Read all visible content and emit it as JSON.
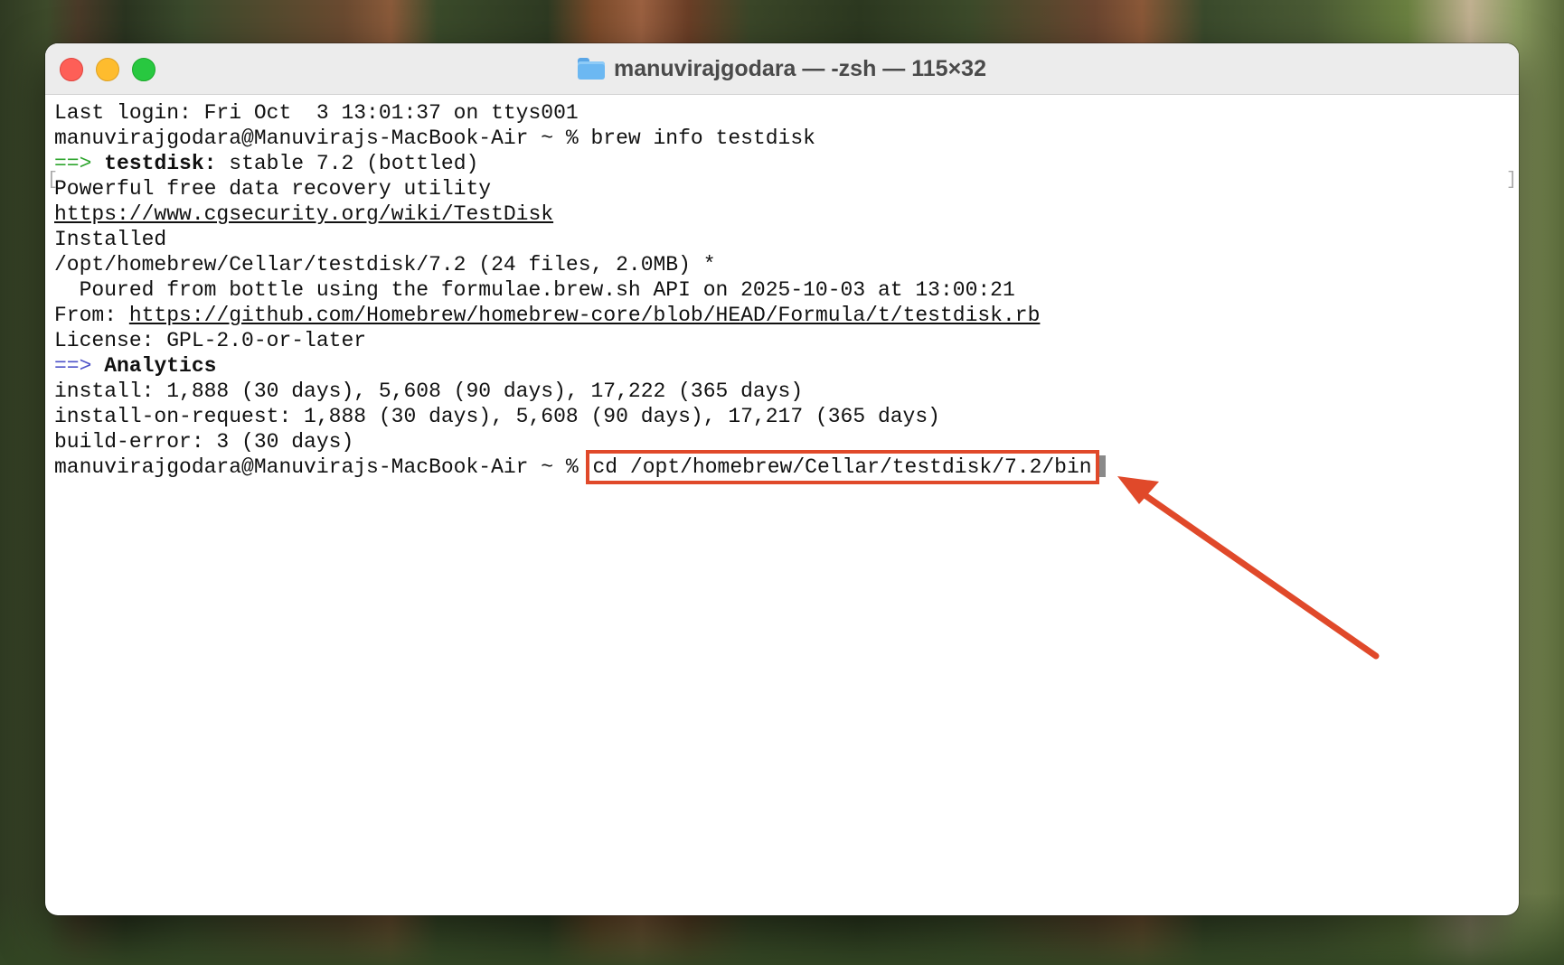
{
  "window": {
    "title": "manuvirajgodara — -zsh — 115×32"
  },
  "terminal": {
    "lines": [
      {
        "text": "Last login: Fri Oct  3 13:01:37 on ttys001"
      },
      {
        "text": "manuvirajgodara@Manuvirajs-MacBook-Air ~ % brew info testdisk"
      },
      {
        "arrow": "==>",
        "bold": "testdisk:",
        "rest": " stable 7.2 (bottled)"
      },
      {
        "text": "Powerful free data recovery utility"
      },
      {
        "link": "https://www.cgsecurity.org/wiki/TestDisk"
      },
      {
        "text": "Installed"
      },
      {
        "text": "/opt/homebrew/Cellar/testdisk/7.2 (24 files, 2.0MB) *"
      },
      {
        "text": "  Poured from bottle using the formulae.brew.sh API on 2025-10-03 at 13:00:21"
      },
      {
        "prefix": "From: ",
        "link": "https://github.com/Homebrew/homebrew-core/blob/HEAD/Formula/t/testdisk.rb"
      },
      {
        "text": "License: GPL-2.0-or-later"
      },
      {
        "arrow": "==>",
        "bold": "Analytics"
      },
      {
        "text": "install: 1,888 (30 days), 5,608 (90 days), 17,222 (365 days)"
      },
      {
        "text": "install-on-request: 1,888 (30 days), 5,608 (90 days), 17,217 (365 days)"
      },
      {
        "text": "build-error: 3 (30 days)"
      }
    ],
    "prompt": "manuvirajgodara@Manuvirajs-MacBook-Air ~ % ",
    "current_command": "cd /opt/homebrew/Cellar/testdisk/7.2/bin"
  },
  "colors": {
    "highlight": "#e0492a",
    "arrow_green": "#2ea52e",
    "arrow_blue": "#4d52c8"
  }
}
